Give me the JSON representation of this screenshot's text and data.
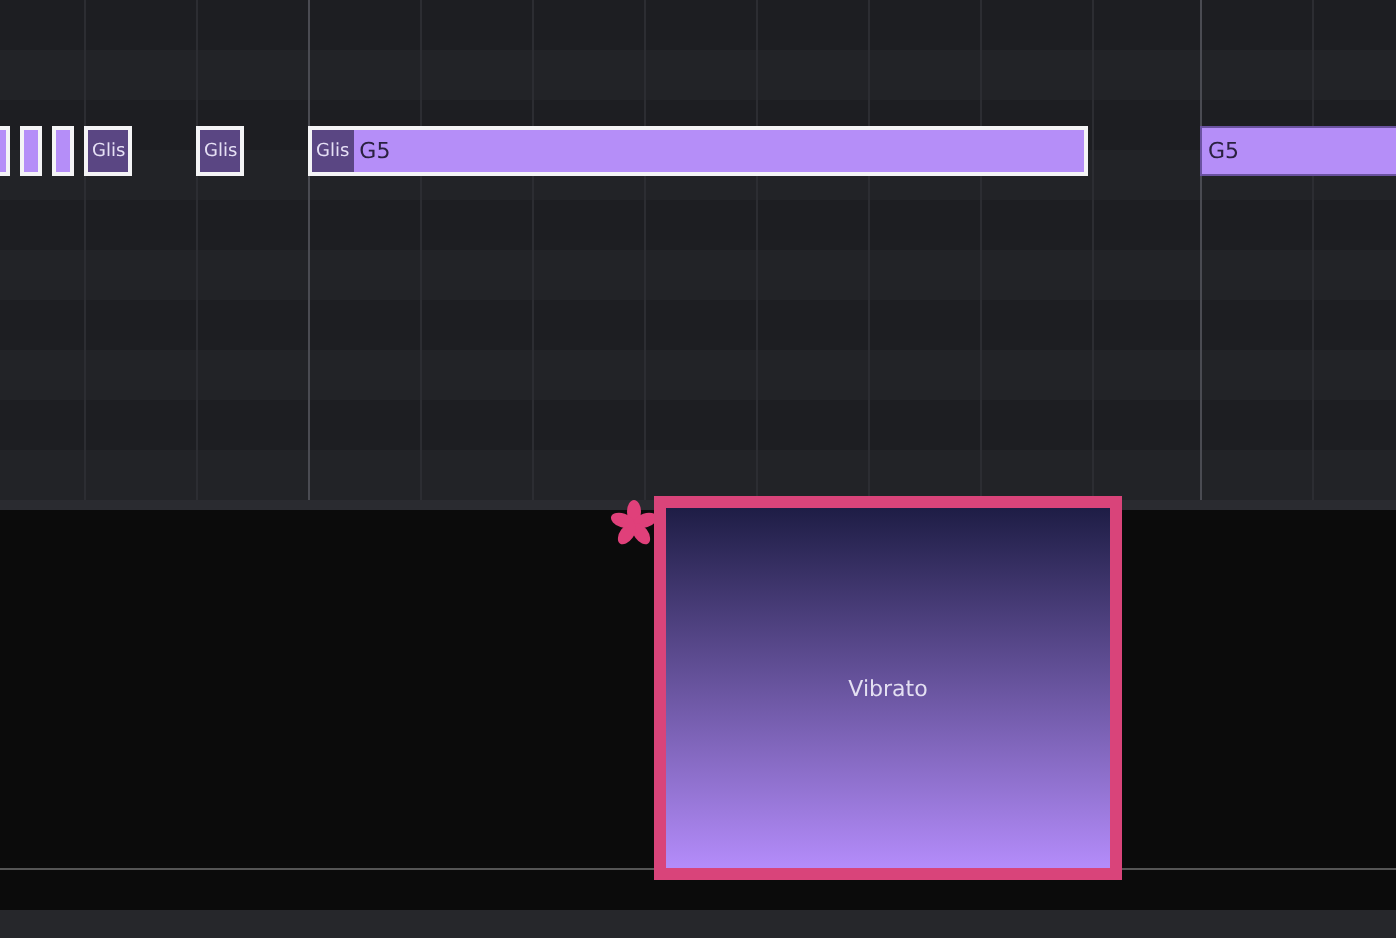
{
  "notes": [
    {
      "selected": true
    },
    {
      "selected": true
    },
    {
      "selected": true
    },
    {
      "selected": true,
      "glide": "Glis"
    },
    {
      "selected": true,
      "glide": "Glis"
    },
    {
      "selected": true,
      "glide": "Glis",
      "pitch": "G5"
    },
    {
      "selected": false,
      "pitch": "G5"
    }
  ],
  "vibrato": {
    "label": "Vibrato",
    "selected": true
  }
}
